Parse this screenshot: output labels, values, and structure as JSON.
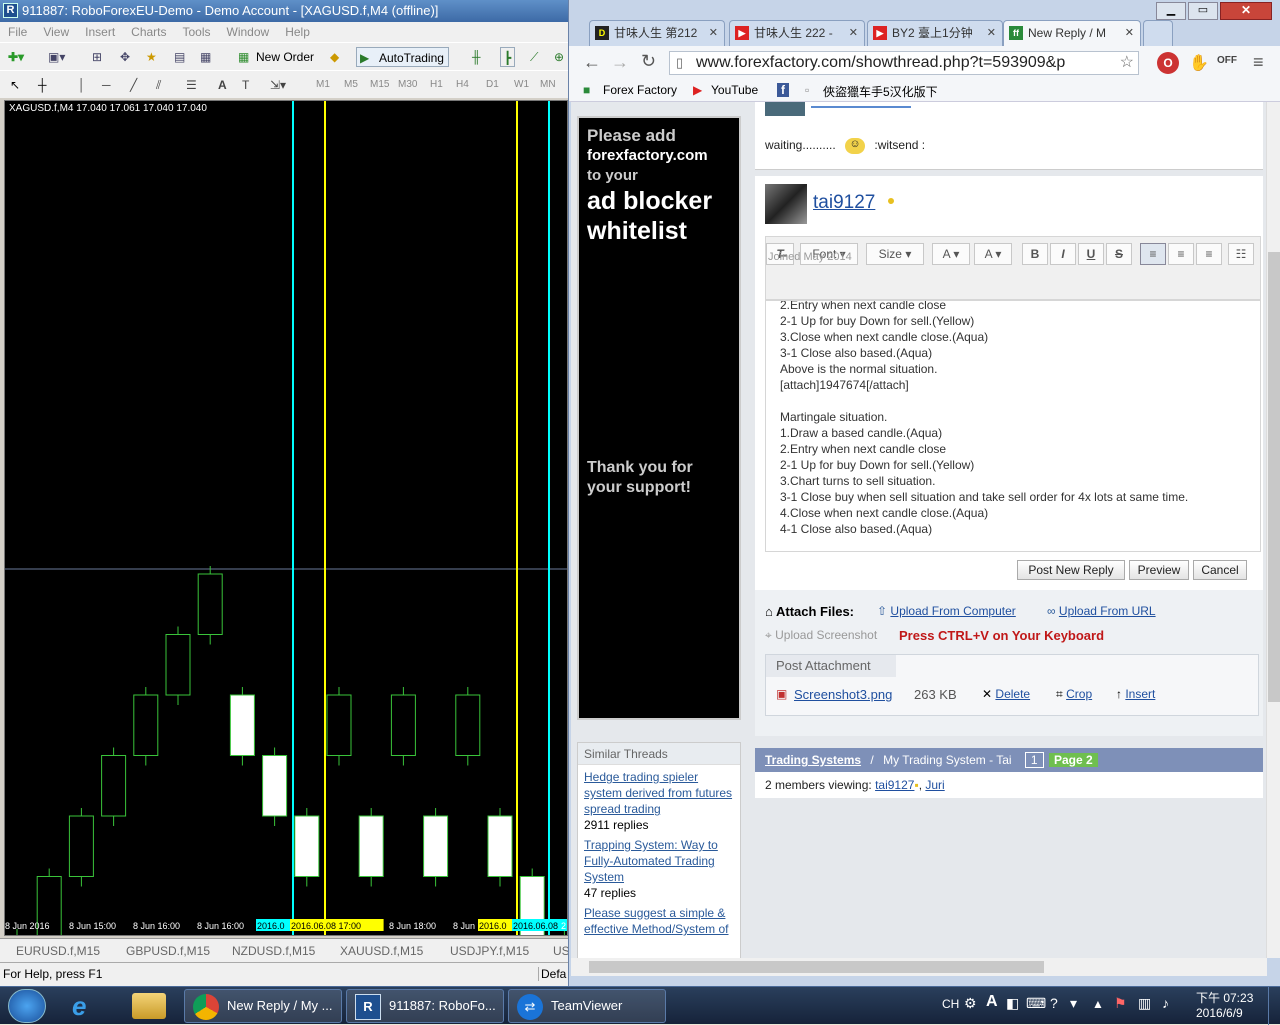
{
  "mt4": {
    "title": "911887: RoboForexEU-Demo - Demo Account - [XAGUSD.f,M4 (offline)]",
    "menu": [
      "File",
      "View",
      "Insert",
      "Charts",
      "Tools",
      "Window",
      "Help"
    ],
    "new_order": "New Order",
    "autotrading": "AutoTrading",
    "timeframes": [
      "M1",
      "M5",
      "M15",
      "M30",
      "H1",
      "H4",
      "D1",
      "W1",
      "MN"
    ],
    "chart_info": "XAGUSD.f,M4  17.040 17.061 17.040 17.040",
    "time_labels": [
      "8 Jun 2016",
      "8 Jun 15:00",
      "8 Jun 16:00",
      "8 Jun 16:00",
      "2016.0",
      "2016.06.08 17:00",
      "8 Jun 18:00",
      "8 Jun",
      "2016.0",
      "2016.06.08",
      "2"
    ],
    "symbol_tabs": [
      "EURUSD.f,M15",
      "GBPUSD.f,M15",
      "NZDUSD.f,M15",
      "XAUUSD.f,M15",
      "USDJPY.f,M15",
      "US"
    ],
    "status_left": "For Help, press F1",
    "status_right": "Defa"
  },
  "chart_data": {
    "type": "candlestick",
    "candles": [
      {
        "dir": "up",
        "o": 0,
        "c": 0,
        "h": 0,
        "l": 0
      },
      {
        "dir": "up"
      },
      {
        "dir": "up"
      },
      {
        "dir": "up"
      },
      {
        "dir": "up"
      },
      {
        "dir": "up"
      },
      {
        "dir": "up"
      },
      {
        "dir": "down"
      },
      {
        "dir": "down"
      },
      {
        "dir": "down"
      },
      {
        "dir": "up"
      },
      {
        "dir": "down"
      },
      {
        "dir": "up"
      },
      {
        "dir": "down"
      },
      {
        "dir": "up"
      },
      {
        "dir": "down"
      },
      {
        "dir": "down"
      },
      {
        "dir": "down"
      }
    ],
    "levels": [
      5,
      6,
      7,
      8,
      9,
      10,
      11,
      10,
      9,
      8,
      9,
      8,
      9,
      8,
      9,
      8,
      7,
      6
    ],
    "vlines_color": [
      "#00ffff",
      "#ffff00",
      "#ffff00",
      "#00ffff"
    ],
    "hline": true
  },
  "chrome": {
    "tabs": [
      {
        "label": "甘味人生 第212",
        "fav": "D",
        "color": "#222"
      },
      {
        "label": "甘味人生 222 -",
        "fav": "▶",
        "color": "#d22"
      },
      {
        "label": "BY2 臺上1分钟",
        "fav": "▶",
        "color": "#d22"
      },
      {
        "label": "New Reply / M",
        "fav": "ff",
        "color": "#2a8a3a"
      }
    ],
    "url": "www.forexfactory.com/showthread.php?t=593909&p",
    "bookmarks": [
      "Forex Factory",
      "YouTube",
      "f",
      "俠盜獵车手5汉化版下"
    ]
  },
  "ad": {
    "line1": "Please add",
    "line2": "forexfactory.com",
    "line3": "to your",
    "line4": "ad blocker",
    "line5": "whitelist",
    "thanks": "Thank you for your support!"
  },
  "similar": {
    "header": "Similar Threads",
    "threads": [
      {
        "title": "Hedge trading spieler system derived from futures spread trading",
        "replies": "2911 replies"
      },
      {
        "title": "Trapping System: Way to Fully-Automated Trading System",
        "replies": "47 replies"
      },
      {
        "title": "Please suggest a simple & effective Method/System of",
        "replies": ""
      }
    ]
  },
  "prev_post": {
    "text": "waiting..........",
    "suffix": ":witsend :"
  },
  "reply": {
    "user": "tai9127",
    "joined": "Joined May 2014",
    "font_label": "Font",
    "size_label": "Size",
    "lines": [
      "2.Entry when next candle close",
      "2-1 Up for buy Down for sell.(Yellow)",
      "3.Close when next candle close.(Aqua)",
      "3-1 Close also based.(Aqua)",
      "Above is the normal situation.",
      "[attach]1947674[/attach]",
      "",
      "Martingale situation.",
      "1.Draw a based candle.(Aqua)",
      "2.Entry when next candle close",
      "2-1 Up for buy Down for sell.(Yellow)",
      "3.Chart turns to sell situation.",
      "3-1 Close buy when sell situation and take sell order for 4x lots at same time.",
      "4.Close when next candle close.(Aqua)",
      "4-1 Close also based.(Aqua)"
    ],
    "post_btn": "Post New Reply",
    "preview_btn": "Preview",
    "cancel_btn": "Cancel",
    "attach_label": "Attach Files:",
    "upload_computer": "Upload From Computer",
    "upload_url": "Upload From URL",
    "upload_screenshot": "Upload Screenshot",
    "ctrl_v": "Press CTRL+V on Your Keyboard",
    "post_attachment": "Post Attachment",
    "file_name": "Screenshot3.png",
    "file_size": "263 KB",
    "delete": "Delete",
    "crop": "Crop",
    "insert": "Insert"
  },
  "breadcrumb": {
    "forum": "Trading Systems",
    "sep": "/",
    "thread": "My Trading System - Tai",
    "page1": "1",
    "page2": "Page 2"
  },
  "members": {
    "prefix": "2 members viewing:",
    "user1": "tai9127",
    "user2": "Juri"
  },
  "taskbar": {
    "tasks": [
      "New Reply / My ...",
      "911887: RoboFo...",
      "TeamViewer"
    ],
    "ime": "CH",
    "time": "下午 07:23",
    "date": "2016/6/9"
  }
}
